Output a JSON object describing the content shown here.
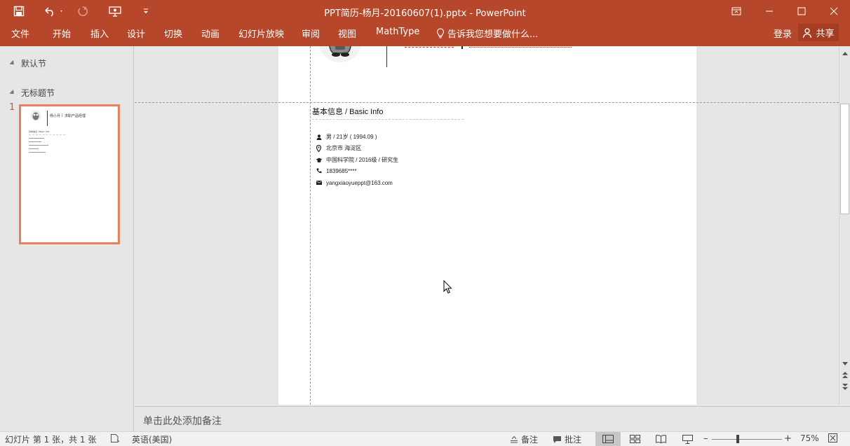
{
  "window": {
    "title": "PPT简历-杨月-20160607(1).pptx - PowerPoint",
    "colors": {
      "accent": "#b7472a",
      "thumb_border": "#e8805d",
      "slide_number": "#d35230"
    }
  },
  "ribbon": {
    "tabs": [
      "文件",
      "开始",
      "插入",
      "设计",
      "切换",
      "动画",
      "幻灯片放映",
      "审阅",
      "视图",
      "MathType"
    ],
    "tell_me": "告诉我您想要做什么...",
    "login": "登录",
    "share": "共享"
  },
  "slides_panel": {
    "sections": [
      "默认节",
      "无标题节"
    ],
    "slide_number": "1",
    "thumbnail": {
      "name": "杨小月",
      "tagline": "求职产品经理",
      "heading": "基本信息 / Basic Info"
    }
  },
  "slide": {
    "section_heading": "基本信息 / Basic Info",
    "info": [
      {
        "icon": "person-icon",
        "text": "男 / 21岁 ( 1994.09 )"
      },
      {
        "icon": "location-pin-icon",
        "text": "北京市 海淀区"
      },
      {
        "icon": "graduation-cap-icon",
        "text": "中国科学院  / 2016级 / 研究生"
      },
      {
        "icon": "phone-icon",
        "text": "1839685****"
      },
      {
        "icon": "envelope-icon",
        "text": "yangxiaoyueppt@163.com"
      }
    ]
  },
  "notes": {
    "placeholder": "单击此处添加备注"
  },
  "statusbar": {
    "slide_info": "幻灯片 第 1 张，共 1 张",
    "language": "英语(美国)",
    "notes_label": "备注",
    "comments_label": "批注",
    "zoom": "75%"
  }
}
